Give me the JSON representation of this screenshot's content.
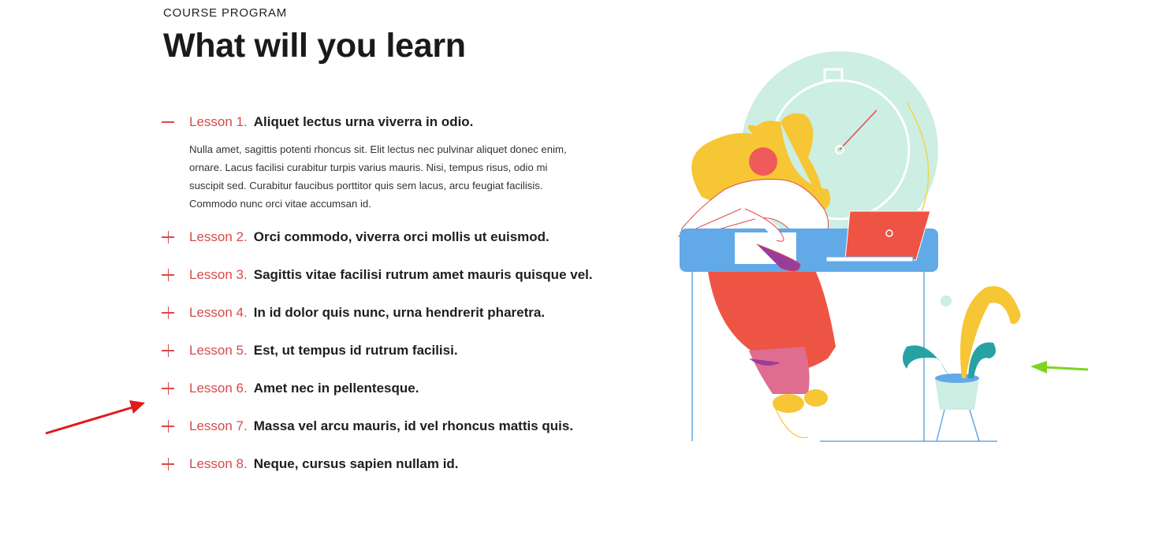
{
  "section": {
    "eyebrow": "COURSE PROGRAM",
    "title": "What will you learn"
  },
  "lessons": [
    {
      "number": "Lesson 1.",
      "title": "Aliquet lectus urna viverra in odio.",
      "expanded": true,
      "body": "Nulla amet, sagittis potenti rhoncus sit. Elit lectus nec pulvinar aliquet donec enim, ornare. Lacus facilisi curabitur turpis varius mauris. Nisi, tempus risus, odio mi suscipit sed. Curabitur faucibus porttitor quis sem lacus, arcu feugiat facilisis. Commodo nunc orci vitae accumsan id."
    },
    {
      "number": "Lesson 2.",
      "title": "Orci commodo, viverra orci mollis ut euismod.",
      "expanded": false
    },
    {
      "number": "Lesson 3.",
      "title": "Sagittis vitae facilisi rutrum amet mauris quisque vel.",
      "expanded": false
    },
    {
      "number": "Lesson 4.",
      "title": "In id dolor quis nunc, urna hendrerit pharetra.",
      "expanded": false
    },
    {
      "number": "Lesson 5.",
      "title": "Est, ut tempus id rutrum facilisi.",
      "expanded": false
    },
    {
      "number": "Lesson 6.",
      "title": "Amet nec in pellentesque.",
      "expanded": false
    },
    {
      "number": "Lesson 7.",
      "title": "Massa vel arcu mauris, id vel rhoncus mattis quis.",
      "expanded": false
    },
    {
      "number": "Lesson 8.",
      "title": "Neque, cursus sapien nullam id.",
      "expanded": false
    }
  ],
  "colors": {
    "accent": "#d84a4a",
    "heading": "#1a1a1a",
    "annotation_red": "#e01b1b",
    "annotation_green": "#7ed321"
  },
  "icons": {
    "expanded": "minus-icon",
    "collapsed": "plus-icon"
  }
}
